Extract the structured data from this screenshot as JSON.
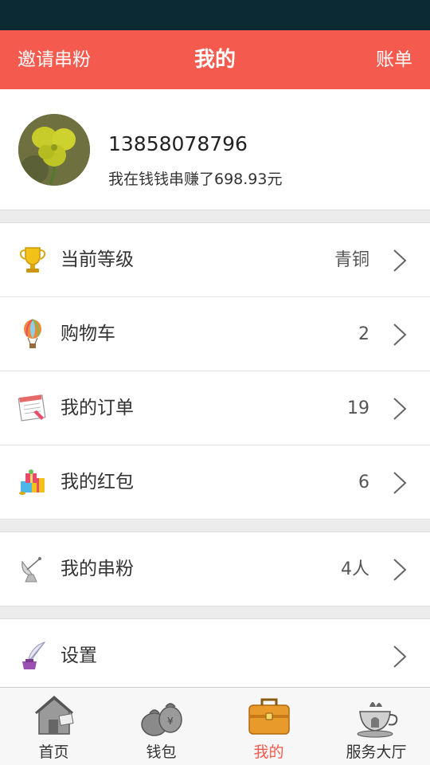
{
  "header": {
    "left_link": "邀请串粉",
    "title": "我的",
    "right_link": "账单"
  },
  "profile": {
    "phone": "13858078796",
    "earned_text": "我在钱钱串赚了698.93元"
  },
  "menu": [
    {
      "icon": "trophy-icon",
      "label": "当前等级",
      "value": "青铜"
    },
    {
      "icon": "hot-air-balloon-icon",
      "label": "购物车",
      "value": "2"
    },
    {
      "icon": "calendar-order-icon",
      "label": "我的订单",
      "value": "19"
    },
    {
      "icon": "gift-box-icon",
      "label": "我的红包",
      "value": "6"
    }
  ],
  "fans": {
    "icon": "satellite-dish-icon",
    "label": "我的串粉",
    "value": "4人"
  },
  "settings": {
    "icon": "quill-ink-icon",
    "label": "设置"
  },
  "tabs": [
    {
      "icon": "house-icon",
      "label": "首页",
      "active": false
    },
    {
      "icon": "money-bag-icon",
      "label": "钱包",
      "active": false
    },
    {
      "icon": "briefcase-icon",
      "label": "我的",
      "active": true
    },
    {
      "icon": "teacup-icon",
      "label": "服务大厅",
      "active": false
    }
  ],
  "colors": {
    "accent": "#f55a4e",
    "status_bar": "#0b2a33"
  }
}
